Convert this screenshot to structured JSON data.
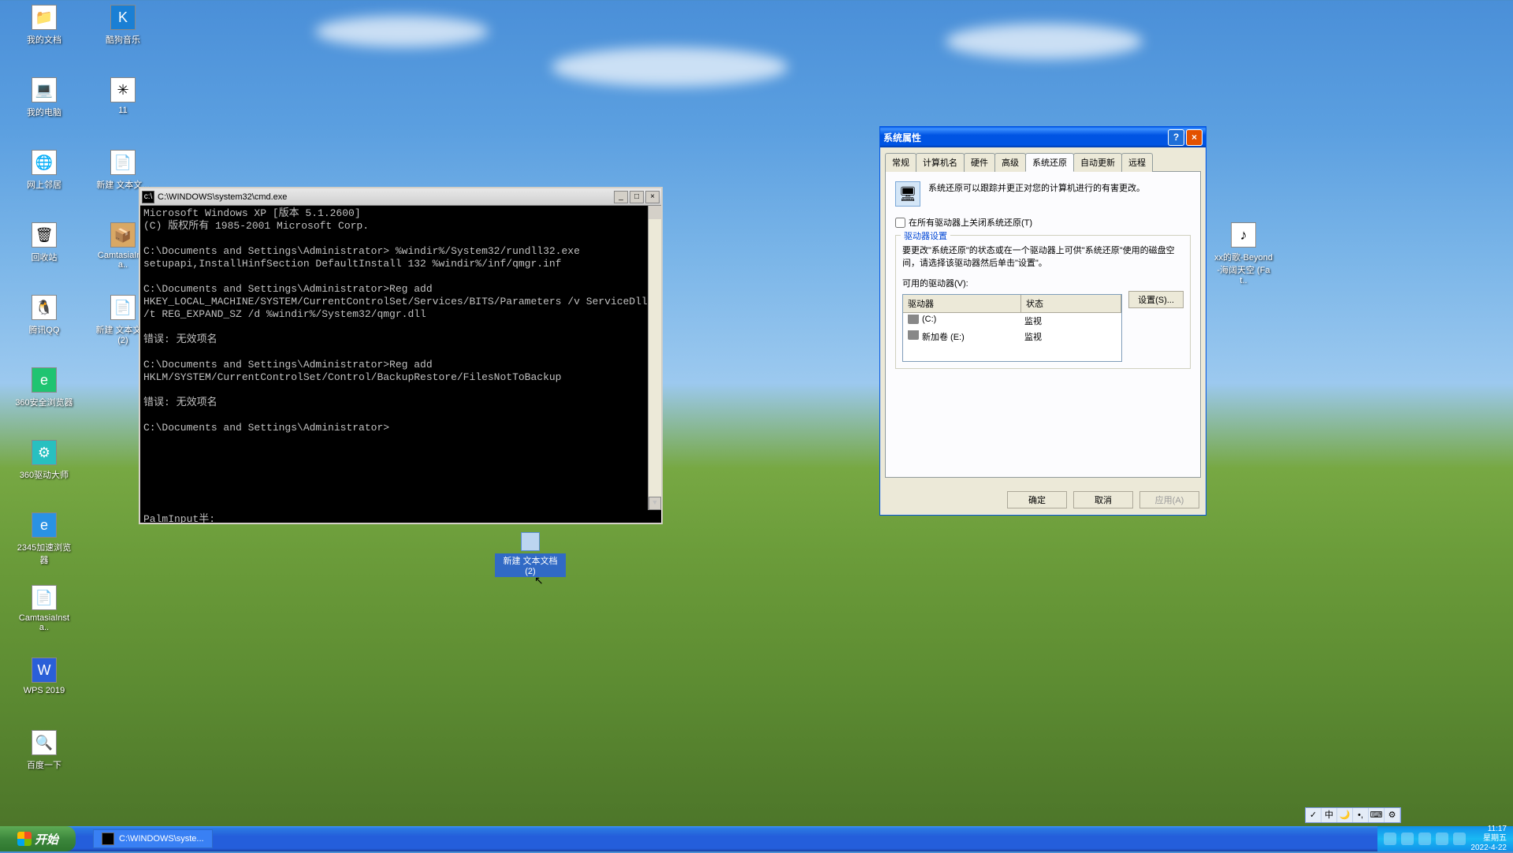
{
  "desktop": {
    "icons": [
      {
        "label": "我的文档",
        "glyph": "📁"
      },
      {
        "label": "我的电脑",
        "glyph": "💻"
      },
      {
        "label": "网上邻居",
        "glyph": "🌐"
      },
      {
        "label": "回收站",
        "glyph": "🗑"
      },
      {
        "label": "腾讯QQ",
        "glyph": "🐧"
      },
      {
        "label": "360安全浏览器",
        "glyph": "e"
      },
      {
        "label": "360驱动大师",
        "glyph": "⚙"
      },
      {
        "label": "2345加速浏览器",
        "glyph": "e"
      },
      {
        "label": "CamtasiaInsta..",
        "glyph": "📄"
      },
      {
        "label": "WPS 2019",
        "glyph": "W"
      },
      {
        "label": "百度一下",
        "glyph": "🔍"
      },
      {
        "label": "酷狗音乐",
        "glyph": "K"
      },
      {
        "label": "11",
        "glyph": "✳"
      },
      {
        "label": "新建 文本文...",
        "glyph": "📄"
      },
      {
        "label": "CamtasiaInsta..",
        "glyph": "📦"
      },
      {
        "label": "新建 文本文档 (2)",
        "glyph": "📄"
      },
      {
        "label": "xx的歌-Beyond-海阔天空 (Fat..",
        "glyph": "♪"
      }
    ]
  },
  "cmd": {
    "title": "C:\\WINDOWS\\system32\\cmd.exe",
    "lines": [
      "Microsoft Windows XP [版本 5.1.2600]",
      "(C) 版权所有 1985-2001 Microsoft Corp.",
      "",
      "C:\\Documents and Settings\\Administrator> %windir%/System32/rundll32.exe setupapi,InstallHinfSection DefaultInstall 132 %windir%/inf/qmgr.inf",
      "",
      "C:\\Documents and Settings\\Administrator>Reg add HKEY_LOCAL_MACHINE/SYSTEM/CurrentControlSet/Services/BITS/Parameters /v ServiceDll /t REG_EXPAND_SZ /d %windir%/System32/qmgr.dll",
      "",
      "错误: 无效项名",
      "",
      "C:\\Documents and Settings\\Administrator>Reg add HKLM/SYSTEM/CurrentControlSet/Control/BackupRestore/FilesNotToBackup",
      "",
      "错误: 无效项名",
      "",
      "C:\\Documents and Settings\\Administrator>"
    ],
    "status": "PalmInput半:"
  },
  "dialog": {
    "title": "系统属性",
    "tabs": [
      "常规",
      "计算机名",
      "硬件",
      "高级",
      "系统还原",
      "自动更新",
      "远程"
    ],
    "activeTab": 4,
    "restore": {
      "desc": "系统还原可以跟踪并更正对您的计算机进行的有害更改。",
      "checkbox": "在所有驱动器上关闭系统还原(T)",
      "group_title": "驱动器设置",
      "group_desc": "要更改\"系统还原\"的状态或在一个驱动器上可供\"系统还原\"使用的磁盘空间，请选择该驱动器然后单击\"设置\"。",
      "list_label": "可用的驱动器(V):",
      "col_drive": "驱动器",
      "col_status": "状态",
      "rows": [
        {
          "name": "(C:)",
          "status": "监视"
        },
        {
          "name": "新加卷 (E:)",
          "status": "监视"
        }
      ],
      "settings_btn": "设置(S)..."
    },
    "buttons": {
      "ok": "确定",
      "cancel": "取消",
      "apply": "应用(A)"
    }
  },
  "floating": {
    "label": "新建 文本文档 (2)"
  },
  "taskbar": {
    "start": "开始",
    "task": "C:\\WINDOWS\\syste...",
    "ime": [
      "✓",
      "中",
      "🌙",
      "•,",
      "⌨",
      "⚙"
    ],
    "clock_time": "11:17",
    "clock_day": "星期五",
    "clock_date": "2022-4-22"
  }
}
